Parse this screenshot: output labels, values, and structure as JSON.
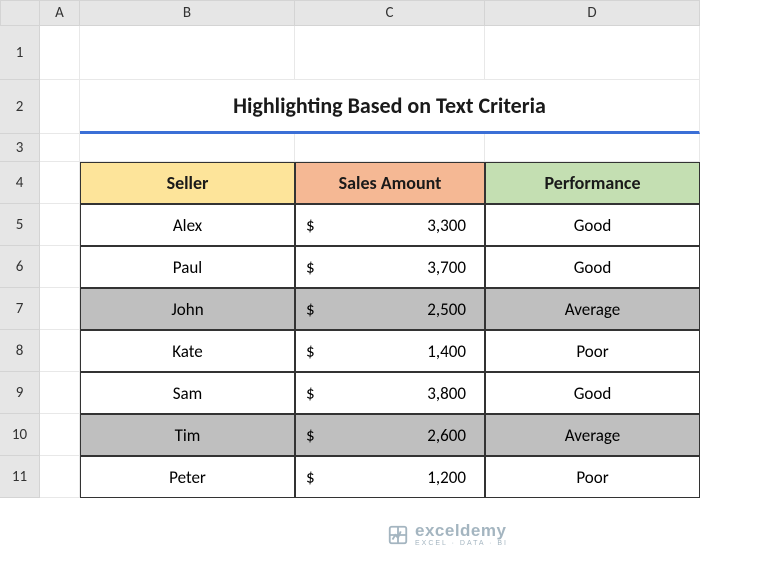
{
  "columns": [
    "A",
    "B",
    "C",
    "D"
  ],
  "rows": [
    "1",
    "2",
    "3",
    "4",
    "5",
    "6",
    "7",
    "8",
    "9",
    "10",
    "11"
  ],
  "title": "Highlighting Based on Text Criteria",
  "headers": {
    "seller": "Seller",
    "sales": "Sales Amount",
    "performance": "Performance"
  },
  "currency_symbol": "$",
  "data_rows": [
    {
      "seller": "Alex",
      "amount": "3,300",
      "performance": "Good",
      "highlight": false
    },
    {
      "seller": "Paul",
      "amount": "3,700",
      "performance": "Good",
      "highlight": false
    },
    {
      "seller": "John",
      "amount": "2,500",
      "performance": "Average",
      "highlight": true
    },
    {
      "seller": "Kate",
      "amount": "1,400",
      "performance": "Poor",
      "highlight": false
    },
    {
      "seller": "Sam",
      "amount": "3,800",
      "performance": "Good",
      "highlight": false
    },
    {
      "seller": "Tim",
      "amount": "2,600",
      "performance": "Average",
      "highlight": true
    },
    {
      "seller": "Peter",
      "amount": "1,200",
      "performance": "Poor",
      "highlight": false
    }
  ],
  "watermark": {
    "main": "exceldemy",
    "sub": "EXCEL · DATA · BI"
  },
  "chart_data": {
    "type": "table",
    "title": "Highlighting Based on Text Criteria",
    "columns": [
      "Seller",
      "Sales Amount",
      "Performance"
    ],
    "rows": [
      [
        "Alex",
        3300,
        "Good"
      ],
      [
        "Paul",
        3700,
        "Good"
      ],
      [
        "John",
        2500,
        "Average"
      ],
      [
        "Kate",
        1400,
        "Poor"
      ],
      [
        "Sam",
        3800,
        "Good"
      ],
      [
        "Tim",
        2600,
        "Average"
      ],
      [
        "Peter",
        1200,
        "Poor"
      ]
    ],
    "highlighted_performance": "Average"
  }
}
